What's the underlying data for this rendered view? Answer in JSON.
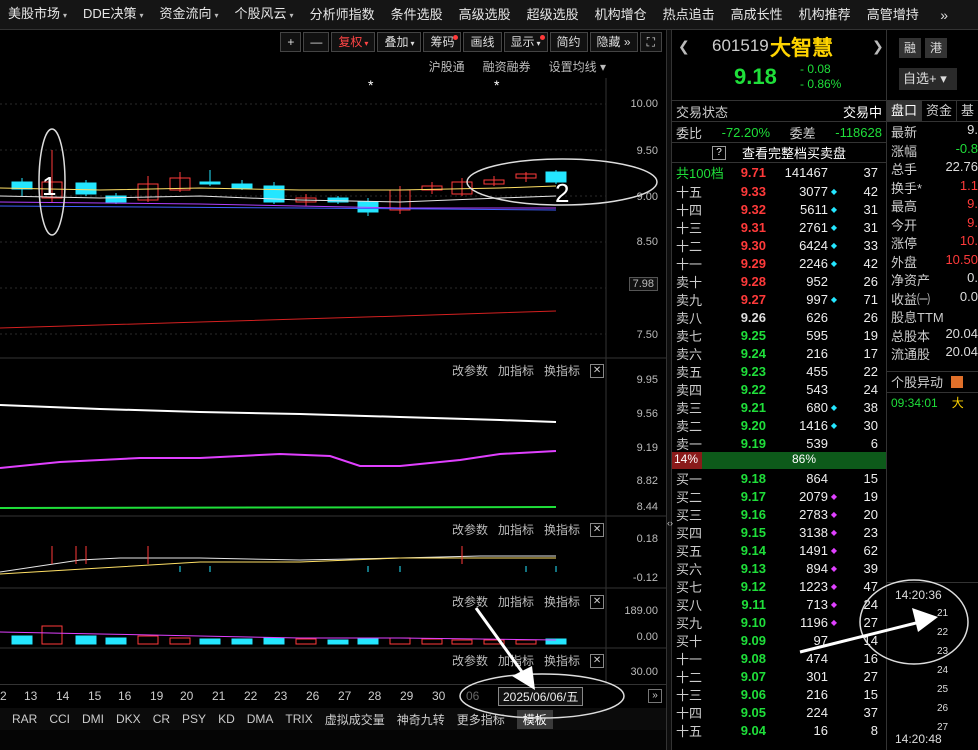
{
  "menu": [
    "美股市场",
    "DDE决策",
    "资金流向",
    "个股风云",
    "分析师指数",
    "条件选股",
    "高级选股",
    "超级选股",
    "机构增仓",
    "热点追击",
    "高成长性",
    "机构推荐",
    "高管增持"
  ],
  "menu_dropdowns": [
    true,
    true,
    true,
    true,
    false,
    false,
    false,
    false,
    false,
    false,
    false,
    false,
    false
  ],
  "menu_more": "»",
  "toolbar": {
    "plus": "+",
    "minus": "—",
    "fuquan": "复权",
    "diejia": "叠加",
    "chouma": "筹码",
    "huaxian": "画线",
    "xianshi": "显示",
    "jianyue": "简约",
    "yincang": "隐藏",
    "more": "»",
    "fullscreen": "⛶"
  },
  "subtoolbar": [
    "沪股通",
    "融资融券",
    "设置均线"
  ],
  "kline": {
    "axis": [
      "10.00",
      "9.50",
      "9.00",
      "8.50",
      "7.98",
      "7.50"
    ],
    "annotation_1": "1",
    "annotation_2": "2",
    "star": "*"
  },
  "panels": [
    {
      "actions": [
        "改参数",
        "加指标",
        "换指标"
      ],
      "close": "✕",
      "axis": [
        "9.95",
        "9.56",
        "9.19",
        "8.82",
        "8.44"
      ]
    },
    {
      "actions": [
        "改参数",
        "加指标",
        "换指标"
      ],
      "close": "✕",
      "axis": [
        "0.18",
        "-0.12"
      ]
    },
    {
      "actions": [
        "改参数",
        "加指标",
        "换指标"
      ],
      "close": "✕",
      "axis": [
        "189.00",
        "0.00"
      ]
    },
    {
      "actions": [
        "改参数",
        "加指标",
        "换指标"
      ],
      "close": "✕",
      "axis": [
        "30.00"
      ]
    }
  ],
  "dates": [
    "2",
    "13",
    "14",
    "15",
    "16",
    "19",
    "20",
    "21",
    "22",
    "23",
    "26",
    "27",
    "28",
    "29",
    "30",
    "06"
  ],
  "date_badge": "2025/06/06/五",
  "date_more": "»",
  "indicators": [
    "RAR",
    "CCI",
    "DMI",
    "DKX",
    "CR",
    "PSY",
    "KD",
    "DMA",
    "TRIX",
    "虚拟成交量",
    "神奇九转",
    "更多指标",
    "模板"
  ],
  "stock": {
    "code": "601519",
    "name": "大智慧",
    "price": "9.18",
    "change": "- 0.08",
    "change_pct": "- 0.86%",
    "prev_arrow": "❮",
    "next_arrow": "❯"
  },
  "status": {
    "label": "交易状态",
    "value": "交易中"
  },
  "weibi": {
    "label1": "委比",
    "val1": "-72.20%",
    "label2": "委差",
    "val2": "-118628"
  },
  "full_book": {
    "q": "?",
    "label": "查看完整档买卖盘"
  },
  "total_levels": {
    "label": "共100档",
    "price": "9.71",
    "vol": "141467",
    "cnt": "37"
  },
  "asks": [
    {
      "lv": "十五",
      "price": "9.33",
      "vol": "3077",
      "cnt": "42",
      "mk": true
    },
    {
      "lv": "十四",
      "price": "9.32",
      "vol": "5611",
      "cnt": "31",
      "mk": true
    },
    {
      "lv": "十三",
      "price": "9.31",
      "vol": "2761",
      "cnt": "31",
      "mk": true
    },
    {
      "lv": "十二",
      "price": "9.30",
      "vol": "6424",
      "cnt": "33",
      "mk": true
    },
    {
      "lv": "十一",
      "price": "9.29",
      "vol": "2246",
      "cnt": "42",
      "mk": true
    },
    {
      "lv": "卖十",
      "price": "9.28",
      "vol": "952",
      "cnt": "26",
      "mk": false
    },
    {
      "lv": "卖九",
      "price": "9.27",
      "vol": "997",
      "cnt": "71",
      "mk": true
    },
    {
      "lv": "卖八",
      "price": "9.26",
      "vol": "626",
      "cnt": "26",
      "mk": false
    },
    {
      "lv": "卖七",
      "price": "9.25",
      "vol": "595",
      "cnt": "19",
      "mk": false
    },
    {
      "lv": "卖六",
      "price": "9.24",
      "vol": "216",
      "cnt": "17",
      "mk": false
    },
    {
      "lv": "卖五",
      "price": "9.23",
      "vol": "455",
      "cnt": "22",
      "mk": false
    },
    {
      "lv": "卖四",
      "price": "9.22",
      "vol": "543",
      "cnt": "24",
      "mk": false
    },
    {
      "lv": "卖三",
      "price": "9.21",
      "vol": "680",
      "cnt": "38",
      "mk": true
    },
    {
      "lv": "卖二",
      "price": "9.20",
      "vol": "1416",
      "cnt": "30",
      "mk": true
    },
    {
      "lv": "卖一",
      "price": "9.19",
      "vol": "539",
      "cnt": "6",
      "mk": false
    }
  ],
  "ratio": {
    "red": "14%",
    "green": "86%"
  },
  "bids": [
    {
      "lv": "买一",
      "price": "9.18",
      "vol": "864",
      "cnt": "15",
      "mk": false
    },
    {
      "lv": "买二",
      "price": "9.17",
      "vol": "2079",
      "cnt": "19",
      "mk": true
    },
    {
      "lv": "买三",
      "price": "9.16",
      "vol": "2783",
      "cnt": "20",
      "mk": true
    },
    {
      "lv": "买四",
      "price": "9.15",
      "vol": "3138",
      "cnt": "23",
      "mk": true
    },
    {
      "lv": "买五",
      "price": "9.14",
      "vol": "1491",
      "cnt": "62",
      "mk": true
    },
    {
      "lv": "买六",
      "price": "9.13",
      "vol": "894",
      "cnt": "39",
      "mk": true
    },
    {
      "lv": "买七",
      "price": "9.12",
      "vol": "1223",
      "cnt": "47",
      "mk": true
    },
    {
      "lv": "买八",
      "price": "9.11",
      "vol": "713",
      "cnt": "24",
      "mk": true
    },
    {
      "lv": "买九",
      "price": "9.10",
      "vol": "1196",
      "cnt": "27",
      "mk": true
    },
    {
      "lv": "买十",
      "price": "9.09",
      "vol": "97",
      "cnt": "14",
      "mk": false
    },
    {
      "lv": "十一",
      "price": "9.08",
      "vol": "474",
      "cnt": "16",
      "mk": false
    },
    {
      "lv": "十二",
      "price": "9.07",
      "vol": "301",
      "cnt": "27",
      "mk": false
    },
    {
      "lv": "十三",
      "price": "9.06",
      "vol": "216",
      "cnt": "15",
      "mk": false
    },
    {
      "lv": "十四",
      "price": "9.05",
      "vol": "224",
      "cnt": "37",
      "mk": false
    },
    {
      "lv": "十五",
      "price": "9.04",
      "vol": "16",
      "cnt": "8",
      "mk": false
    }
  ],
  "side": {
    "tag1": "融",
    "tag2": "港",
    "select": "自选+",
    "tabs": [
      "盘口",
      "资金",
      "基"
    ],
    "rows": [
      {
        "k": "最新",
        "v": "9."
      },
      {
        "k": "涨幅",
        "v": "-0.8"
      },
      {
        "k": "总手",
        "v": "22.76"
      },
      {
        "k": "换手*",
        "v": "1.1"
      },
      {
        "k": "最高",
        "v": "9."
      },
      {
        "k": "今开",
        "v": "9."
      },
      {
        "k": "涨停",
        "v": "10."
      },
      {
        "k": "外盘",
        "v": "10.50"
      },
      {
        "k": "净资产",
        "v": "0."
      },
      {
        "k": "收益㈠",
        "v": "0.0"
      },
      {
        "k": "股息TTM",
        "v": ""
      },
      {
        "k": "总股本",
        "v": "20.04"
      },
      {
        "k": "流通股",
        "v": "20.04"
      }
    ],
    "alert_title": "个股异动",
    "alert_time": "09:34:01",
    "alert_text": "大",
    "tick_time1": "14:20:36",
    "tick_nums": [
      "21",
      "22",
      "23",
      "24",
      "25",
      "26",
      "27"
    ],
    "tick_time2": "14:20:48"
  },
  "colors": {
    "up": "#ff3a3a",
    "down": "#1fdf3a",
    "cyan": "#24e6ff",
    "yellow": "#ffd400",
    "magenta": "#e040ff"
  }
}
